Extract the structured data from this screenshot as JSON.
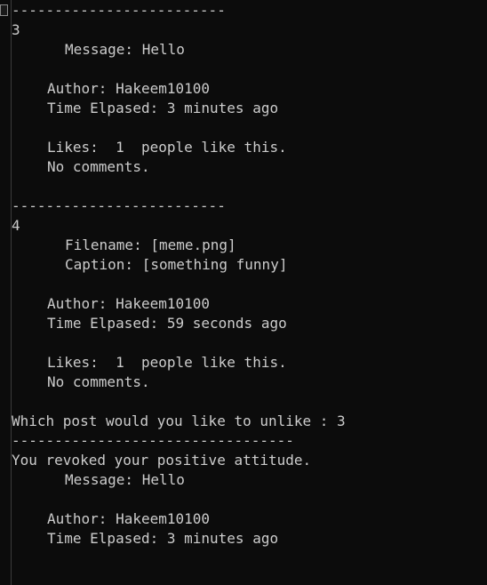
{
  "terminal": {
    "lines": [
      "-------------------------",
      "3",
      "Message: Hello",
      "",
      "Author: Hakeem10100",
      "Time Elpased: 3 minutes ago",
      "",
      "Likes:  1  people like this.",
      "No comments.",
      "",
      "-------------------------",
      "4",
      "Filename: [meme.png]",
      "Caption: [something funny]",
      "",
      "Author: Hakeem10100",
      "Time Elpased: 59 seconds ago",
      "",
      "Likes:  1  people like this.",
      "No comments.",
      "",
      "Which post would you like to unlike : 3",
      "---------------------------------",
      "You revoked your positive attitude.",
      "Message: Hello",
      "",
      "Author: Hakeem10100",
      "Time Elpased: 3 minutes ago"
    ]
  }
}
